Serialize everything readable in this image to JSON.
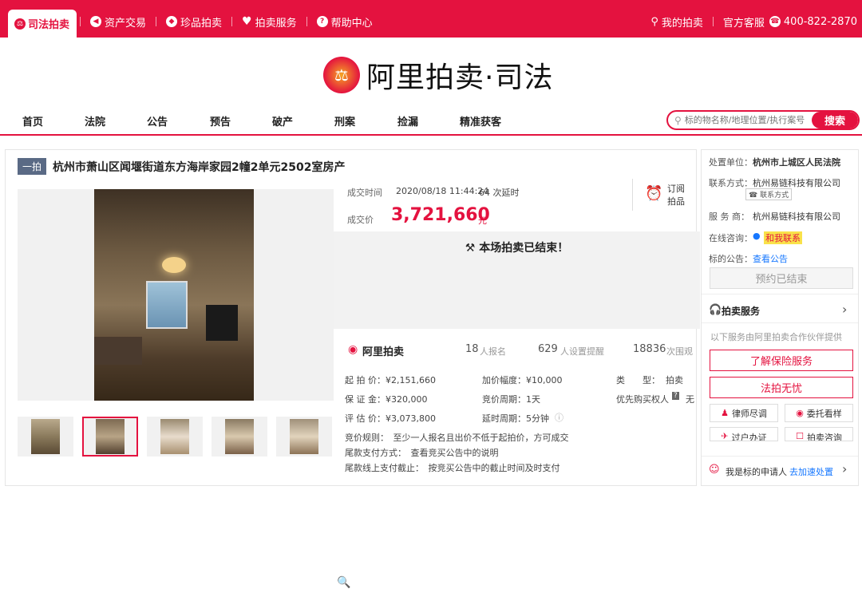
{
  "topbar": {
    "active_tab": "司法拍卖",
    "links": [
      "资产交易",
      "珍品拍卖",
      "拍卖服务",
      "帮助中心"
    ],
    "my_auction": "我的拍卖",
    "service": "官方客服",
    "phone": "400-822-2870"
  },
  "logo": {
    "text": "阿里拍卖·司法"
  },
  "nav": {
    "items": [
      "首页",
      "法院",
      "公告",
      "预告",
      "破产",
      "刑案",
      "捡漏",
      "精准获客"
    ],
    "search_placeholder": "标的物名称/地理位置/执行案号",
    "search_btn": "搜索"
  },
  "item": {
    "badge": "一拍",
    "title": "杭州市萧山区闻堰街道东方海岸家园2幢2单元2502室房产",
    "deal_time_label": "成交时间",
    "deal_time": "2020/08/18 11:44:24",
    "delays": "64 次延时",
    "subscribe": "订阅",
    "subscribe2": "拍品",
    "price_label": "成交价",
    "price": "3,721,660",
    "price_unit": "元",
    "ended": "本场拍卖已结束！",
    "brand": "阿里拍卖",
    "signups": "18",
    "signups_label": "人报名",
    "reminders": "629",
    "reminders_label": "人设置提醒",
    "views": "18836",
    "views_label": "次围观"
  },
  "specs": {
    "start_price": "起 拍 价：¥2,151,660",
    "deposit": "保 证 金：¥320,000",
    "appraisal": "评 估 价：¥3,073,800",
    "increment": "加价幅度：¥10,000",
    "period": "竞价周期：1天",
    "delay": "延时周期：5分钟",
    "type_label": "类　　型：",
    "type_value": "拍卖",
    "priority": "优先购买权人",
    "priority_value": "无",
    "rule": "竞价规则：　至少一人报名且出价不低于起拍价，方可成交",
    "pay_method": "尾款支付方式：　查看竞买公告中的说明",
    "pay_deadline": "尾款线上支付截止：　按竞买公告中的截止时间及时支付"
  },
  "sidebar": {
    "unit_label": "处置单位：",
    "unit": "杭州市上城区人民法院",
    "contact_label": "联系方式：",
    "contact": "杭州易链科技有限公司",
    "contact_tag": "联系方式",
    "provider_label": "服 务 商：",
    "provider": "杭州易链科技有限公司",
    "online_label": "在线咨询：",
    "online": "和我联系",
    "notice_label": "标的公告：",
    "notice": "查看公告",
    "booking": "预约已结束",
    "service_title": "拍卖服务",
    "service_desc": "以下服务由阿里拍卖合作伙伴提供",
    "insurance": "了解保险服务",
    "worry_free": "法拍无忧",
    "lawyer": "律师尽调",
    "entrust": "委托看样",
    "transfer": "过户办证",
    "consult": "拍卖咨询",
    "applicant": "我是标的申请人",
    "fast": "去加速处置"
  }
}
